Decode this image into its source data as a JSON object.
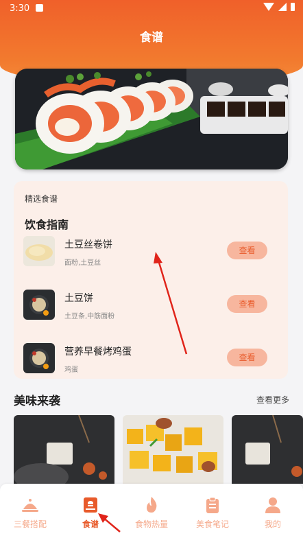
{
  "status": {
    "time": "3:30"
  },
  "header": {
    "title": "食谱"
  },
  "banner": {
    "alt": "sushi-banner"
  },
  "featured": {
    "label": "精选食谱",
    "guide_title": "饮食指南",
    "view_label": "查看",
    "items": [
      {
        "name": "土豆丝卷饼",
        "ingredients": "面粉,土豆丝"
      },
      {
        "name": "土豆饼",
        "ingredients": "土豆条,中筋面粉"
      },
      {
        "name": "营养早餐烤鸡蛋",
        "ingredients": "鸡蛋"
      }
    ]
  },
  "tasty": {
    "title": "美味来袭",
    "more": "查看更多"
  },
  "tabs": [
    {
      "label": "三餐搭配",
      "icon": "cloche-icon"
    },
    {
      "label": "食谱",
      "icon": "recipe-book-icon",
      "active": true
    },
    {
      "label": "食物热量",
      "icon": "flame-icon"
    },
    {
      "label": "美食笔记",
      "icon": "clipboard-icon"
    },
    {
      "label": "我的",
      "icon": "person-icon"
    }
  ],
  "colors": {
    "accent": "#e85a2a",
    "header": "#f0602a",
    "tab_inactive": "#f5a88a",
    "button_bg": "#f7b69e",
    "panel_bg": "#fcefe9"
  }
}
